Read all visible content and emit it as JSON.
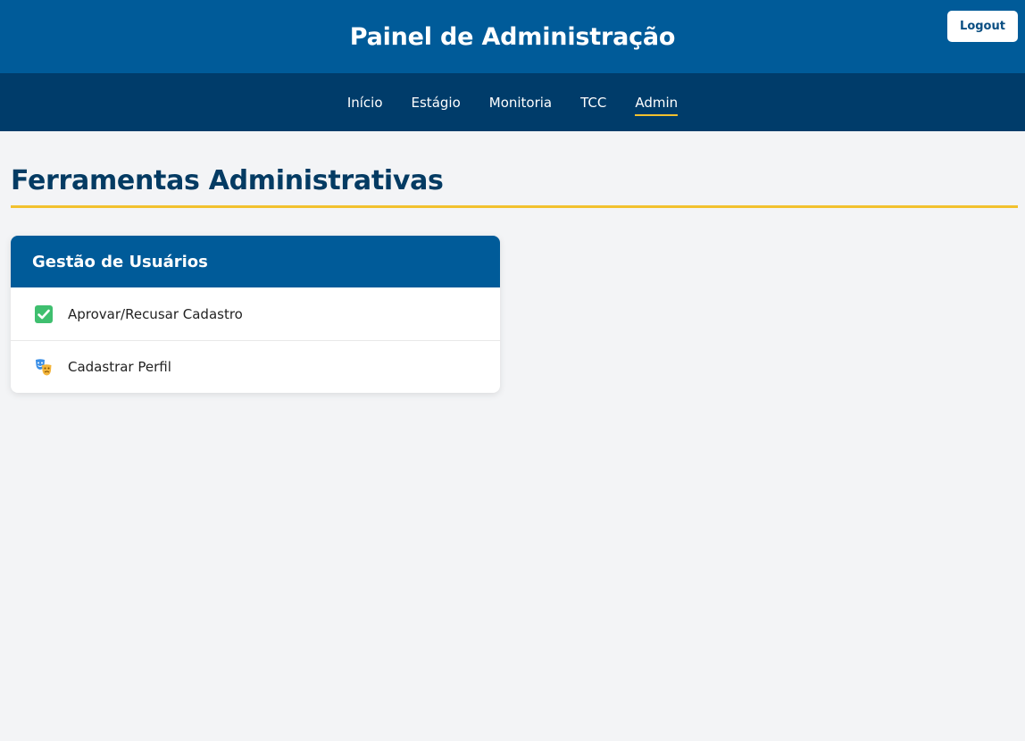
{
  "header": {
    "title": "Painel de Administração",
    "logout_label": "Logout"
  },
  "nav": {
    "items": [
      {
        "label": "Início",
        "active": false
      },
      {
        "label": "Estágio",
        "active": false
      },
      {
        "label": "Monitoria",
        "active": false
      },
      {
        "label": "TCC",
        "active": false
      },
      {
        "label": "Admin",
        "active": true
      }
    ]
  },
  "main": {
    "title": "Ferramentas Administrativas",
    "card": {
      "title": "Gestão de Usuários",
      "items": [
        {
          "label": "Aprovar/Recusar Cadastro",
          "icon": "check-mark-icon"
        },
        {
          "label": "Cadastrar Perfil",
          "icon": "theater-masks-icon"
        }
      ]
    }
  },
  "colors": {
    "primary": "#005b99",
    "nav_dark": "#003c6a",
    "accent": "#f2c12e",
    "title_text": "#043b63",
    "background": "#f3f4f6"
  }
}
